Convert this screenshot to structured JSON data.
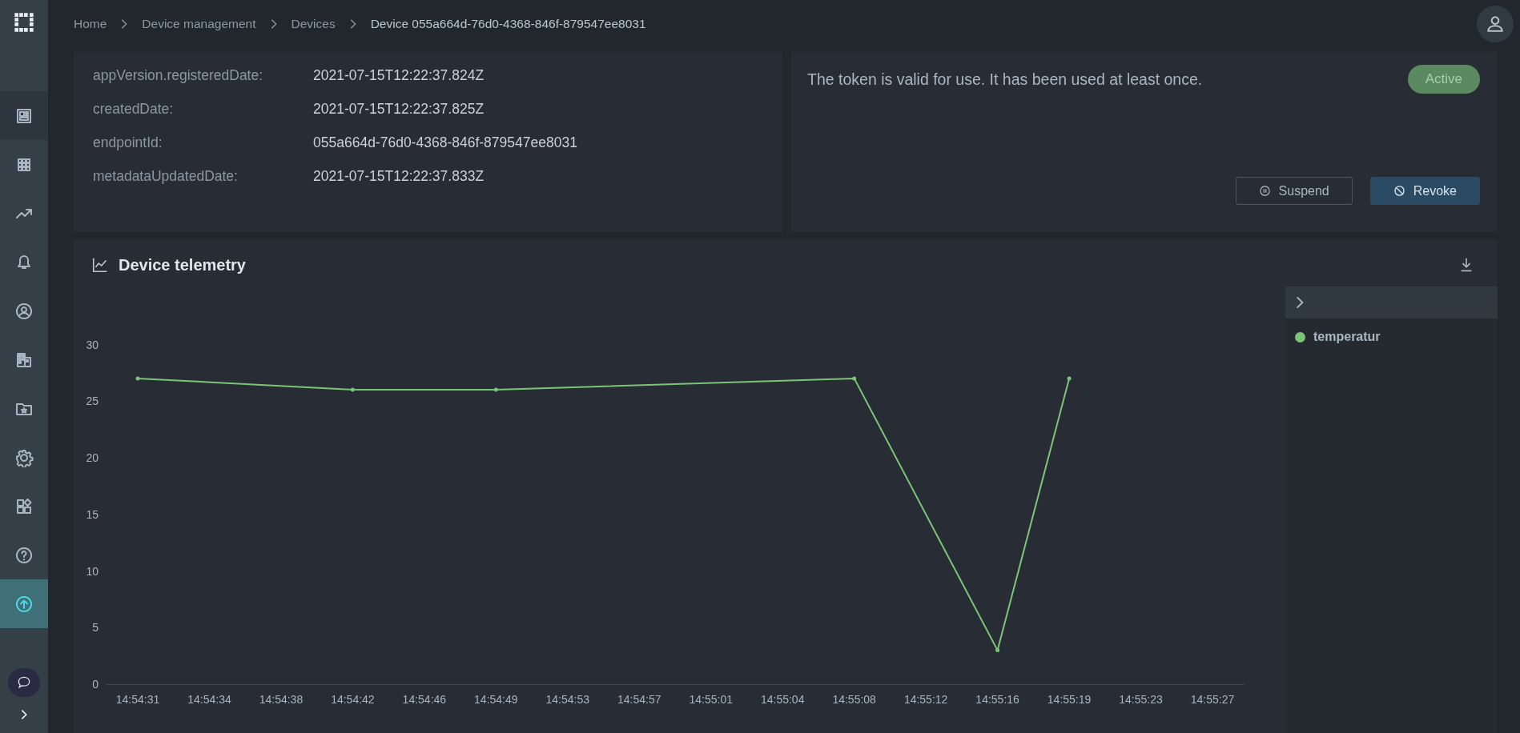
{
  "sidebar": {
    "items": [
      {
        "selected": false
      },
      {
        "selected": false
      },
      {
        "selected": false
      },
      {
        "selected": false
      },
      {
        "selected": false
      },
      {
        "selected": false
      },
      {
        "selected": false
      },
      {
        "selected": false
      },
      {
        "selected": false
      },
      {
        "selected": false
      },
      {
        "selected": true
      }
    ]
  },
  "breadcrumb": [
    {
      "label": "Home"
    },
    {
      "label": "Device management"
    },
    {
      "label": "Devices"
    },
    {
      "label": "Device 055a664d-76d0-4368-846f-879547ee8031"
    }
  ],
  "details": [
    {
      "key": "appVersion.registeredDate:",
      "value": "2021-07-15T12:22:37.824Z"
    },
    {
      "key": "createdDate:",
      "value": "2021-07-15T12:22:37.825Z"
    },
    {
      "key": "endpointId:",
      "value": "055a664d-76d0-4368-846f-879547ee8031"
    },
    {
      "key": "metadataUpdatedDate:",
      "value": "2021-07-15T12:22:37.833Z"
    }
  ],
  "token": {
    "message": "The token is valid for use. It has been used at least once.",
    "status": "Active",
    "buttons": [
      {
        "label": "Suspend",
        "kind": "outline"
      },
      {
        "label": "Revoke",
        "kind": "primary"
      }
    ]
  },
  "telemetry": {
    "title": "Device telemetry",
    "chart_data": {
      "type": "line",
      "categories": [
        "14:54:31",
        "14:54:34",
        "14:54:38",
        "14:54:42",
        "14:54:46",
        "14:54:49",
        "14:54:53",
        "14:54:57",
        "14:55:01",
        "14:55:04",
        "14:55:08",
        "14:55:12",
        "14:55:16",
        "14:55:19",
        "14:55:23",
        "14:55:27"
      ],
      "series": [
        {
          "name": "temperatur",
          "color": "#7cc576",
          "values": [
            27,
            null,
            null,
            26,
            null,
            26,
            null,
            null,
            null,
            null,
            27,
            null,
            3,
            27,
            null,
            null
          ]
        }
      ],
      "ylim": [
        0,
        30
      ],
      "yticks": [
        0,
        5,
        10,
        15,
        20,
        25,
        30
      ]
    }
  }
}
